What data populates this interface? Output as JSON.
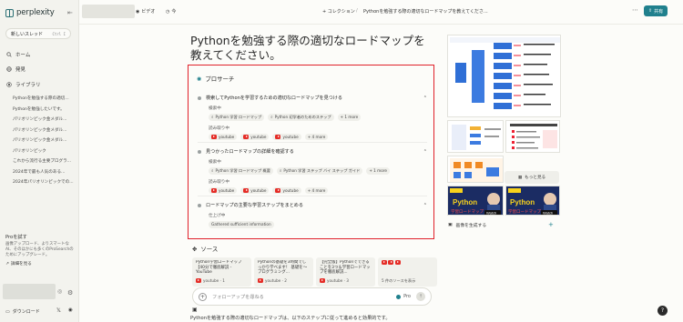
{
  "sidebar": {
    "logo_text": "perplexity",
    "new_thread_label": "新しいスレッド",
    "new_thread_shortcut": "Ctrl I",
    "nav": [
      {
        "label": "ホーム",
        "icon": "search-icon"
      },
      {
        "label": "発見",
        "icon": "globe-icon"
      },
      {
        "label": "ライブラリ",
        "icon": "library-icon"
      }
    ],
    "library_items": [
      "Pythonを勉強する際の適切...",
      "Pythonを勉強したいです。",
      "パリオリンピック金メダル...",
      "パリオリンピック金メダル...",
      "パリオリンピック金メダル...",
      "パリオリンピック",
      "これから流行る主要プログラ...",
      "2024年で最も人気のある...",
      "2024年パリオリンピックでの..."
    ],
    "pro": {
      "title": "Proを試す",
      "description": "画像アップロード、よりスマートなAI、そのほかにも多くのProSearchのためにアップグレード。",
      "link": "詳細を見る"
    },
    "download_label": "ダウンロード"
  },
  "topbar": {
    "video_label": "ビデオ",
    "time_label": "今",
    "collection_label": "+ コレクション",
    "separator": "/",
    "thread_title": "Pythonを勉強する際の適切なロードマップを教えてくださ...",
    "share_label": "共有"
  },
  "main": {
    "title": "Pythonを勉強する際の適切なロードマップを教えてください。",
    "research_label": "プロサーチ",
    "steps": [
      {
        "title": "検索してPythonを学習するための適切なロードマップを見つける",
        "search_label": "検索中",
        "queries": [
          "Python 学習 ロードマップ",
          "Python 初学者のためのステップ"
        ],
        "more_queries": "+ 1 more",
        "reading_label": "読み取り中",
        "sources": [
          "youtube",
          "youtube",
          "youtube"
        ],
        "more_sources": "+ 4 more"
      },
      {
        "title": "見つかったロードマップの詳細を確認する",
        "search_label": "検索中",
        "queries": [
          "Python 学習 ロードマップ 概要",
          "Python 学習 ステップ バイ ステップ ガイド"
        ],
        "more_queries": "+ 1 more",
        "reading_label": "読み取り中",
        "sources": [
          "youtube",
          "youtube",
          "youtube"
        ],
        "more_sources": "+ 4 more"
      },
      {
        "title": "ロードマップの主要な学習ステップをまとめる",
        "finish_label": "仕上げ中",
        "result": "Gathered sufficient information"
      }
    ],
    "sources_label": "ソース",
    "source_cards": [
      {
        "title": "Python学習ロードマップ【40分で徹底解説 - YouTube",
        "site": "youtube · 1"
      },
      {
        "title": "Pythonの基礎を3時間でしっかり学べます！ 基礎を〜プログラミング...",
        "site": "youtube · 2"
      },
      {
        "title": "【完全版】Pythonでできることを3つ＆学習ロードマップを徹底解説...",
        "site": "youtube · 3"
      },
      {
        "title": "",
        "site": "5 件のソースを表示"
      }
    ],
    "followup_placeholder": "フォローアップを尋ねる",
    "pro_toggle_label": "Pro",
    "answer_preview": "Pythonを勉強する際の適切なロードマップは、以下のステップに従って進めると効果的です。"
  },
  "right": {
    "more_label": "もっと見る",
    "generate_label": "画像を生成する",
    "thumb_text": "Python",
    "thumb_subtext": "学習ロードマップ",
    "watch_label": "Watch"
  },
  "colors": {
    "accent": "#20808d",
    "highlight_border": "#e0202a",
    "youtube": "#e52d27"
  }
}
